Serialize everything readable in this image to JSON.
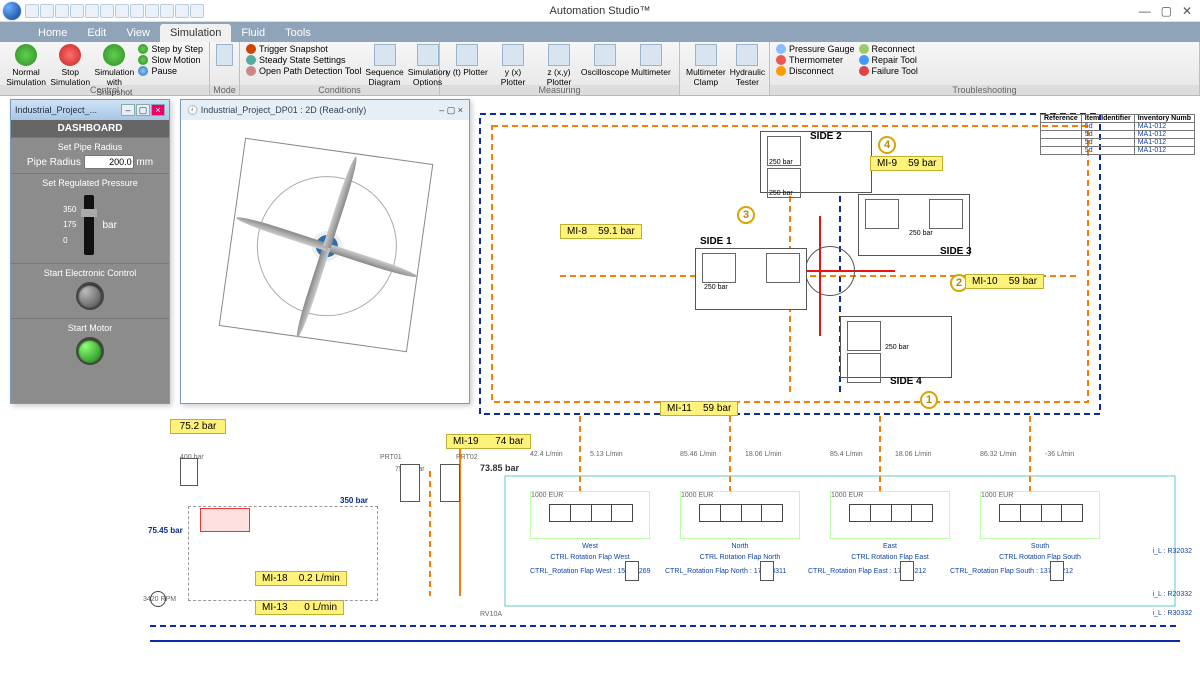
{
  "app": {
    "title": "Automation Studio™"
  },
  "qat_count": 12,
  "win": {
    "min": "—",
    "max": "▢",
    "close": "✕"
  },
  "menu": {
    "tabs": [
      "Home",
      "Edit",
      "View",
      "Simulation",
      "Fluid",
      "Tools"
    ],
    "active": 3
  },
  "ribbon": {
    "control": {
      "label": "Control",
      "normal": "Normal Simulation",
      "stop": "Stop Simulation",
      "snap": "Simulation with Snapshot",
      "step": "Step by Step",
      "slow": "Slow Motion",
      "pause": "Pause"
    },
    "mode": {
      "label": "Mode"
    },
    "conditions": {
      "label": "Conditions",
      "trigger": "Trigger Snapshot",
      "steady": "Steady State Settings",
      "openpath": "Open Path Detection Tool",
      "seq": "Sequence Diagram",
      "opts": "Simulation Options"
    },
    "measuring": {
      "label": "Measuring",
      "yt": "y (t) Plotter",
      "yx": "y (x) Plotter",
      "zxy": "z (x,y) Plotter",
      "osc": "Oscilloscope",
      "mm": "Multimeter",
      "mmc": "Multimeter Clamp",
      "ht": "Hydraulic Tester"
    },
    "trouble": {
      "label": "Troubleshooting",
      "pg": "Pressure Gauge",
      "th": "Thermometer",
      "dis": "Disconnect",
      "rc": "Reconnect",
      "rt": "Repair Tool",
      "ft": "Failure Tool"
    }
  },
  "dashboard_window": {
    "title": "Industrial_Project_...",
    "header": "DASHBOARD",
    "set_radius": "Set Pipe Radius",
    "radius_label": "Pipe Radius",
    "radius_val": "200.0",
    "radius_unit": "mm",
    "set_pressure": "Set Regulated Pressure",
    "scale": [
      "350",
      "175",
      "0"
    ],
    "bar": "bar",
    "start_ec": "Start Electronic Control",
    "start_motor": "Start Motor"
  },
  "view3d": {
    "title": "Industrial_Project_DP01 : 2D (Read-only)"
  },
  "sides": {
    "s1": "SIDE 1",
    "s2": "SIDE 2",
    "s3": "SIDE 3",
    "s4": "SIDE 4"
  },
  "psi_small": "250 bar",
  "numbers": {
    "n1": "1",
    "n2": "2",
    "n3": "3",
    "n4": "4"
  },
  "mi": {
    "mi8": "MI-8",
    "v8": "59.1 bar",
    "mi9": "MI-9",
    "v9": "59 bar",
    "mi10": "MI-10",
    "v10": "59 bar",
    "mi11": "MI-11",
    "v11": "59 bar",
    "mi18": "MI-18",
    "v18": "0.2 L/min",
    "mi13": "MI-13",
    "v13": "0 L/min",
    "mi19": "MI-19",
    "v19": "74 bar",
    "ml75": "75.2 bar",
    "p7545": "75.45 bar",
    "p7385": "73.85 bar",
    "p350": "350 bar",
    "p400": "400 bar",
    "rpm": "3420 RPM"
  },
  "flows": {
    "a1": "42.4 L/min",
    "a2": "5.13 L/min",
    "b1": "85.46 L/min",
    "b2": "18.06 L/min",
    "c1": "85.4 L/min",
    "c2": "18.06 L/min",
    "d1": "86.32 L/min",
    "d2": "-36 L/min"
  },
  "valves": {
    "eur": "1000 EUR",
    "names": [
      "West",
      "North",
      "East",
      "South"
    ],
    "ctrl": [
      "CTRL Rotation Flap West",
      "CTRL Rotation Flap North",
      "CTRL Rotation Flap East",
      "CTRL Rotation Flap South"
    ],
    "below": [
      "CTRL_Rotation Flap West : 1577.5269",
      "CTRL_Rotation Flap North : 1715.8311",
      "CTRL_Rotation Flap East : 1711.5212",
      "CTRL_Rotation Flap South : 1377.4212"
    ]
  },
  "rlabels": [
    "i_L : R32032",
    "i_L : R20332",
    "i_L : R30332"
  ],
  "rvref": "RV10A",
  "prt": {
    "a": "PRT01",
    "b": "PRT02",
    "val": "75.32 bar"
  },
  "ref_table": {
    "head": [
      "Reference",
      "Item Identifier",
      "Inventory Numb"
    ],
    "rows": [
      [
        "",
        "5d",
        "MA1-012"
      ],
      [
        "",
        "5d",
        "MA1-012"
      ],
      [
        "",
        "5d",
        "MA1-012"
      ],
      [
        "",
        "5d",
        "MA1-012"
      ]
    ]
  }
}
